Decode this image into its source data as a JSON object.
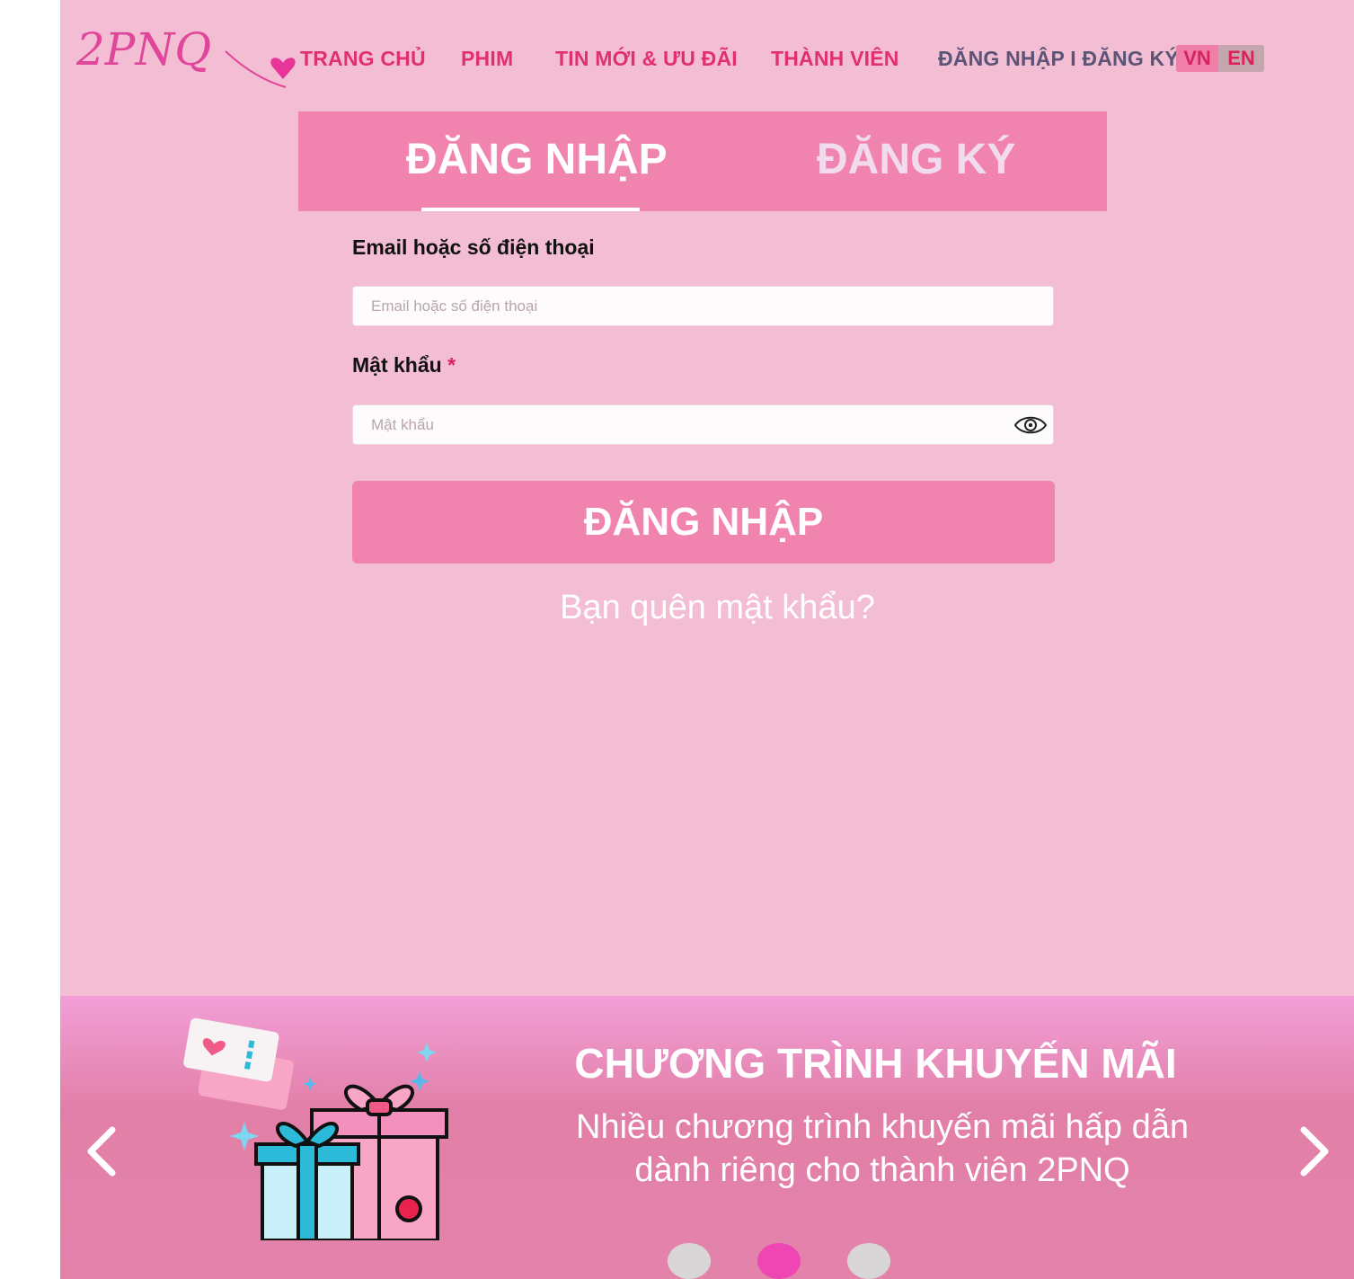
{
  "header": {
    "logo_text": "2PNQ",
    "nav": [
      {
        "label": "TRANG CHỦ"
      },
      {
        "label": "PHIM"
      },
      {
        "label": "TIN MỚI & ƯU ĐÃI"
      },
      {
        "label": "THÀNH VIÊN"
      }
    ],
    "auth_link": "ĐĂNG NHẬP I ĐĂNG KÝ",
    "languages": [
      {
        "code": "VN",
        "active": true
      },
      {
        "code": "EN",
        "active": false
      }
    ]
  },
  "auth_tabs": {
    "login": "ĐĂNG NHẬP",
    "register": "ĐĂNG KÝ",
    "active": "login"
  },
  "form": {
    "email_label": "Email hoặc số điện thoại",
    "email_placeholder": "Email hoặc số điện thoại",
    "email_value": "",
    "password_label": "Mật khẩu",
    "password_required_mark": "*",
    "password_placeholder": "Mật khẩu",
    "password_value": "",
    "submit_label": "ĐĂNG NHẬP",
    "forgot_label": "Bạn quên mật khẩu?"
  },
  "promo_banner": {
    "title": "CHƯƠNG TRÌNH KHUYẾN MÃI",
    "text_line1": "Nhiều chương trình khuyến mãi hấp dẫn",
    "text_line2": "dành riêng cho thành viên 2PNQ",
    "slide_count": 3,
    "active_slide": 2
  },
  "colors": {
    "background": "#f3bdd3",
    "accent": "#f184ae",
    "nav_text": "#e0306e",
    "auth_text": "#5b5476",
    "active_dot": "#f046b4"
  }
}
